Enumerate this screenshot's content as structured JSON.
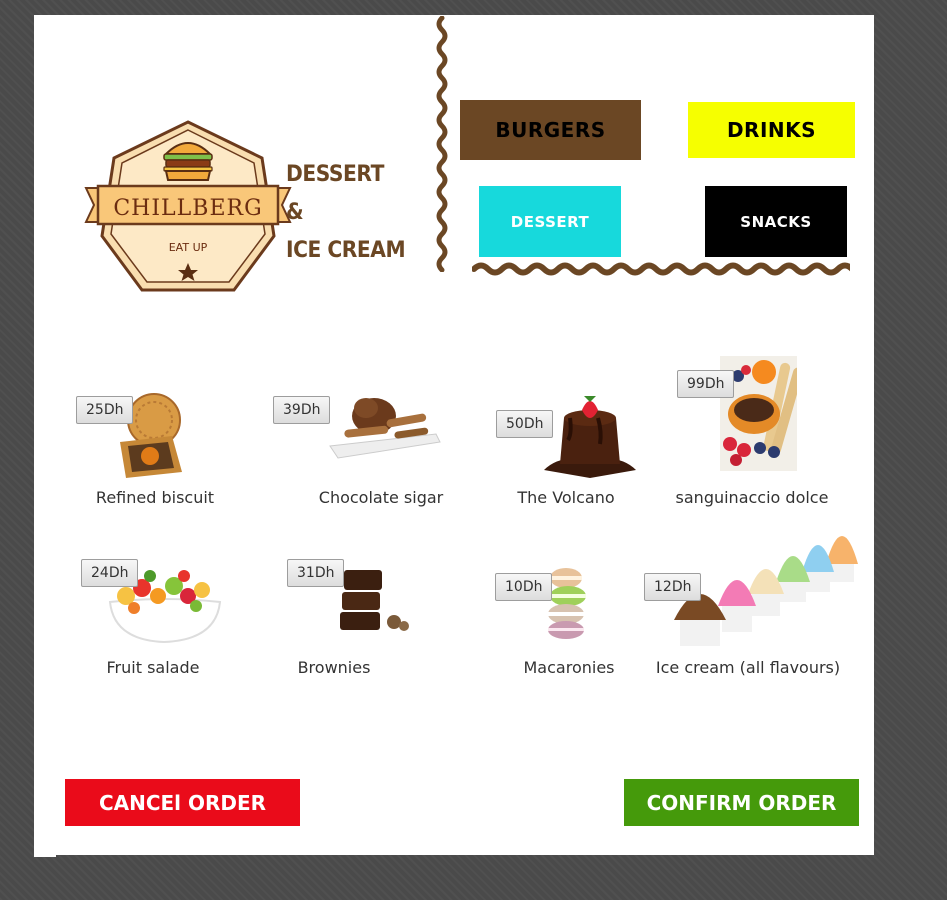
{
  "logo": {
    "brand_name": "CHILLBERG",
    "tagline": "EAT UP",
    "subtitle": "DESSERT &\nICE CREAM"
  },
  "categories": [
    {
      "label": "BURGERS",
      "color": "#6b4724",
      "text_color": "#000000"
    },
    {
      "label": "DRINKS",
      "color": "#f6ff00",
      "text_color": "#000000"
    },
    {
      "label": "DESSERT",
      "color": "#17d9dc",
      "text_color": "#ffffff"
    },
    {
      "label": "SNACKS",
      "color": "#000000",
      "text_color": "#ffffff"
    }
  ],
  "items": [
    {
      "name": "Refined biscuit",
      "price": "25Dh",
      "icon": "biscuit-icon"
    },
    {
      "name": "Chocolate sigar",
      "price": "39Dh",
      "icon": "chocolate-sigar-icon"
    },
    {
      "name": "The Volcano",
      "price": "50Dh",
      "icon": "volcano-cake-icon"
    },
    {
      "name": "sanguinaccio dolce",
      "price": "99Dh",
      "icon": "sanguinaccio-icon"
    },
    {
      "name": "Fruit salade",
      "price": "24Dh",
      "icon": "fruit-salad-icon"
    },
    {
      "name": "Brownies",
      "price": "31Dh",
      "icon": "brownies-icon"
    },
    {
      "name": "Macaronies",
      "price": "10Dh",
      "icon": "macarons-icon"
    },
    {
      "name": "Ice cream (all flavours)",
      "price": "12Dh",
      "icon": "ice-cream-icon"
    }
  ],
  "actions": {
    "cancel": "CANCEl ORDER",
    "confirm": "CONFIRM ORDER",
    "cancel_color": "#ea0b1a",
    "confirm_color": "#459a0b"
  }
}
